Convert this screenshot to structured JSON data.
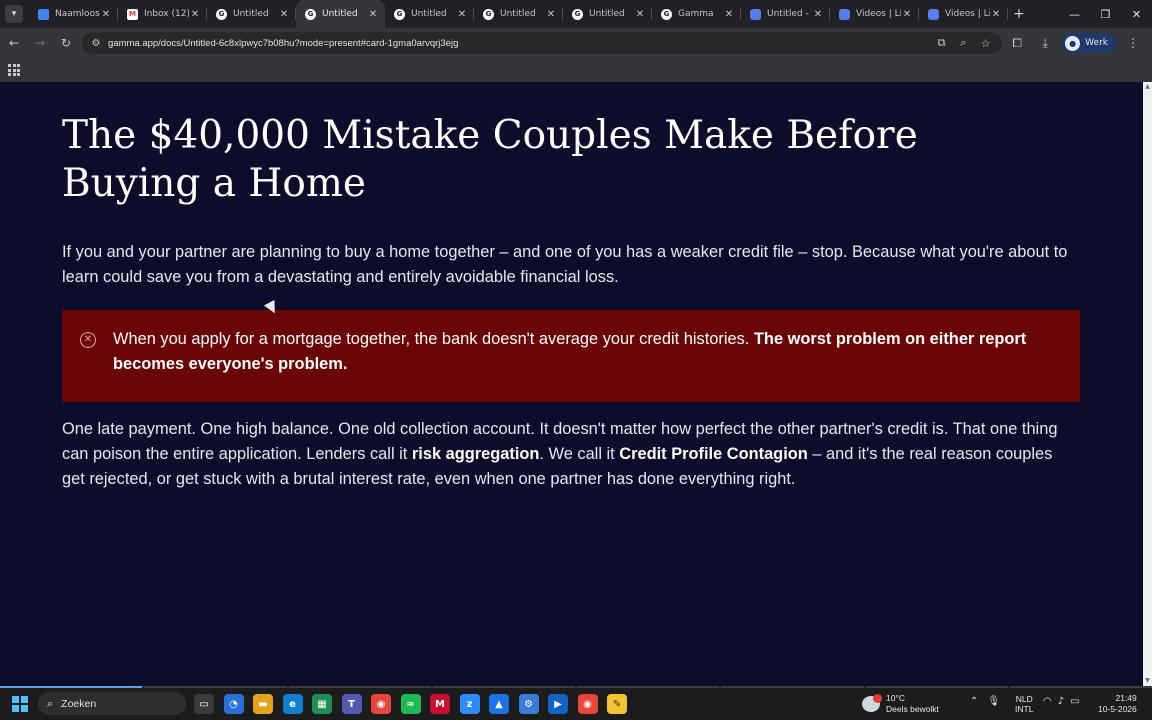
{
  "browser": {
    "tabs": [
      {
        "label": "Naamloos document",
        "icon": "docs-icon",
        "active": false
      },
      {
        "label": "Inbox (12)",
        "icon": "gmail-icon",
        "active": false
      },
      {
        "label": "Untitled",
        "icon": "gamma-icon",
        "active": false
      },
      {
        "label": "Untitled",
        "icon": "gamma-icon",
        "active": true
      },
      {
        "label": "Untitled",
        "icon": "gamma-icon",
        "active": false
      },
      {
        "label": "Untitled",
        "icon": "gamma-icon",
        "active": false
      },
      {
        "label": "Untitled",
        "icon": "gamma-icon",
        "active": false
      },
      {
        "label": "Gamma",
        "icon": "gamma-icon",
        "active": false
      },
      {
        "label": "Untitled - Gamma",
        "icon": "video-icon",
        "active": false
      },
      {
        "label": "Videos | LinkedIn",
        "icon": "video-icon",
        "active": false
      },
      {
        "label": "Videos | LinkedIn",
        "icon": "video-icon",
        "active": false
      }
    ],
    "url": "gamma.app/docs/Untitled-6c8xlpwyc7b08hu?mode=present#card-1gma0arvqrj3ejg",
    "profile_label": "Werk",
    "accent": "#1f3a6a"
  },
  "slide": {
    "title": "The $40,000 Mistake Couples Make Before Buying a Home",
    "intro": "If you and your partner are planning to buy a home together – and one of you has a weaker credit file – stop. Because what you're about to learn could save you from a devastating and entirely avoidable financial loss.",
    "callout": {
      "text_plain": "When you apply for a mortgage together, the bank doesn't average your credit histories. ",
      "text_bold": "The worst problem on either report becomes everyone's problem.",
      "color": "#6b0505"
    },
    "body": {
      "p1": "One late payment. One high balance. One old collection account. It doesn't matter how perfect the other partner's credit is. That one thing can poison the entire application. Lenders call it ",
      "b1": "risk aggregation",
      "p2": ". We call it ",
      "b2": "Credit Profile Contagion",
      "p3": " – and it's the real reason couples get rejected, or get stuck with a brutal interest rate, even when one partner has done everything right."
    },
    "background": "#0d0d2b"
  },
  "taskbar": {
    "search_label": "Zoeken",
    "weather_temp": "10°C",
    "weather_desc": "Deels bewolkt",
    "lang_line1": "NLD",
    "lang_line2": "INTL",
    "time": "21:49",
    "date": "10-5-2026"
  }
}
